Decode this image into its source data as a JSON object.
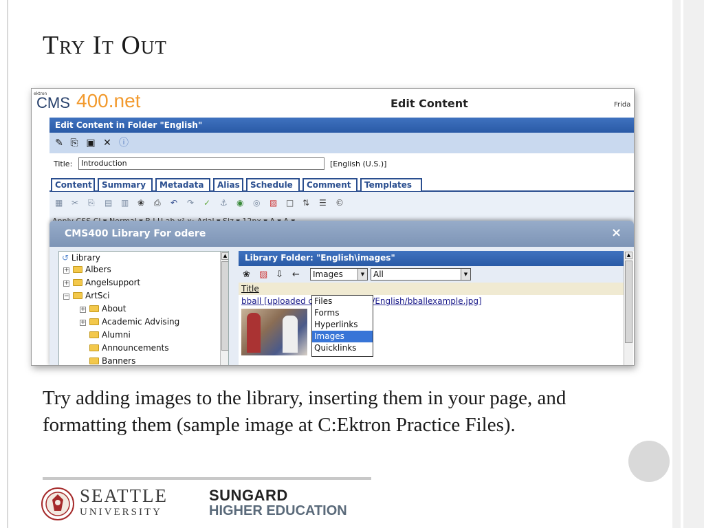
{
  "slide": {
    "title": "Try It Out",
    "caption": "Try adding images to the library, inserting them in your page, and formatting them (sample image at C:Ektron Practice Files).",
    "logos": {
      "seattle_top": "SEATTLE",
      "seattle_bottom": "UNIVERSITY",
      "sungard_top": "SUNGARD",
      "sungard_bottom": "HIGHER EDUCATION"
    },
    "colors": {
      "accent_blue": "#2a5aa6",
      "cms_orange": "#f29a2e",
      "gray_dot": "#d9d9d9"
    }
  },
  "app": {
    "brand_small": "ektron",
    "brand_cms": "CMS",
    "brand_400": "400.net",
    "header_title": "Edit Content",
    "header_date": "Frida",
    "folder_bar": "Edit Content in Folder \"English\"",
    "toolbar_icons": [
      "edit-icon",
      "copy-icon",
      "save-icon",
      "close-icon",
      "help-icon"
    ],
    "title_label": "Title:",
    "title_value": "Introduction",
    "language": "[English (U.S.)]",
    "tabs": [
      "Content",
      "Summary",
      "Metadata",
      "Alias",
      "Schedule",
      "Comment",
      "Templates"
    ],
    "format_row": "Apply CSS Cl ▾ Normal        ▾  B  I  U  ab  x²  x₂  Arial         ▾ Siz ▾ 12px  ▾  A  ▾  A  ▾"
  },
  "library": {
    "dialog_title": "CMS400 Library For odere",
    "close_glyph": "×",
    "tree": {
      "root": "Library",
      "items": [
        {
          "label": "Albers",
          "level": 1,
          "expander": "+"
        },
        {
          "label": "Angelsupport",
          "level": 1,
          "expander": "+"
        },
        {
          "label": "ArtSci",
          "level": 1,
          "expander": "−"
        },
        {
          "label": "About",
          "level": 2,
          "expander": "+"
        },
        {
          "label": "Academic Advising",
          "level": 2,
          "expander": "+"
        },
        {
          "label": "Alumni",
          "level": 2,
          "expander": ""
        },
        {
          "label": "Announcements",
          "level": 2,
          "expander": ""
        },
        {
          "label": "Banners",
          "level": 2,
          "expander": ""
        }
      ]
    },
    "folder_header": "Library Folder: \"English\\images\"",
    "type_select": "Images",
    "filter_select": "All",
    "column_title": "Title",
    "file_link": "bball [uploaded                    ci/Departments/English/bballexample.jpg]",
    "dropdown_options": [
      "Files",
      "Forms",
      "Hyperlinks",
      "Images",
      "Quicklinks"
    ],
    "dropdown_selected": "Images"
  }
}
